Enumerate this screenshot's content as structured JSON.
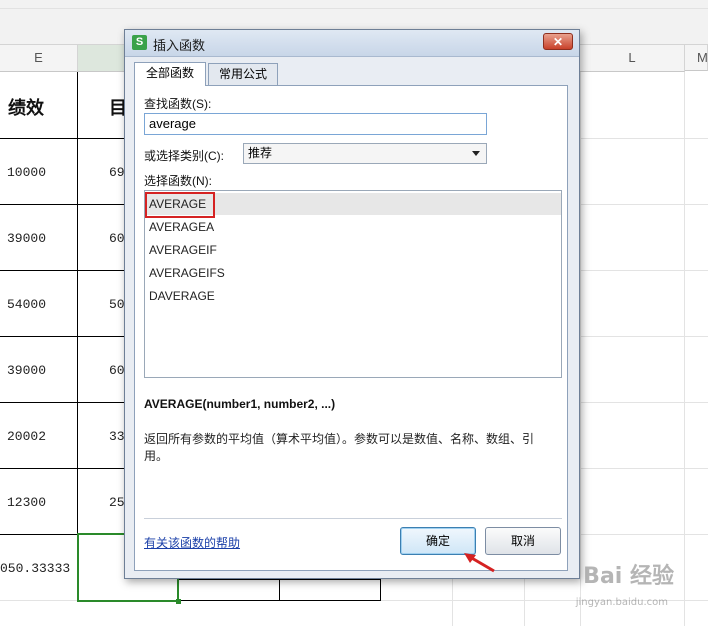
{
  "sheet": {
    "columns": {
      "e": "E",
      "l": "L",
      "m": "M"
    },
    "header_cells": {
      "perf": "绩效",
      "target_partial": "目"
    },
    "rows": [
      {
        "e": "10000",
        "f": "69"
      },
      {
        "e": "39000",
        "f": "60"
      },
      {
        "e": "54000",
        "f": "50"
      },
      {
        "e": "39000",
        "f": "60"
      },
      {
        "e": "20002",
        "f": "33"
      },
      {
        "e": "12300",
        "f": "25"
      },
      {
        "e": "050.33333",
        "f": ""
      }
    ]
  },
  "dialog": {
    "title": "插入函数",
    "app_icon_letter": "S",
    "close_symbol": "✕",
    "tabs": [
      {
        "label": "全部函数",
        "active": true
      },
      {
        "label": "常用公式",
        "active": false
      }
    ],
    "search_label": "查找函数(S):",
    "search_value": "average",
    "category_label": "或选择类别(C):",
    "category_value": "推荐",
    "list_label": "选择函数(N):",
    "functions": [
      "AVERAGE",
      "AVERAGEA",
      "AVERAGEIF",
      "AVERAGEIFS",
      "DAVERAGE"
    ],
    "selected_function": "AVERAGE",
    "syntax": "AVERAGE(number1, number2, ...)",
    "description": "返回所有参数的平均值（算术平均值）。参数可以是数值、名称、数组、引用。",
    "help_link": "有关该函数的帮助",
    "ok_label": "确定",
    "cancel_label": "取消"
  },
  "watermark": {
    "main": "Bai 经验",
    "sub": "jingyan.baidu.com"
  },
  "colors": {
    "selection_green": "#2a8a2a",
    "highlight_red": "#d52222",
    "link_blue": "#1a3fa8"
  }
}
